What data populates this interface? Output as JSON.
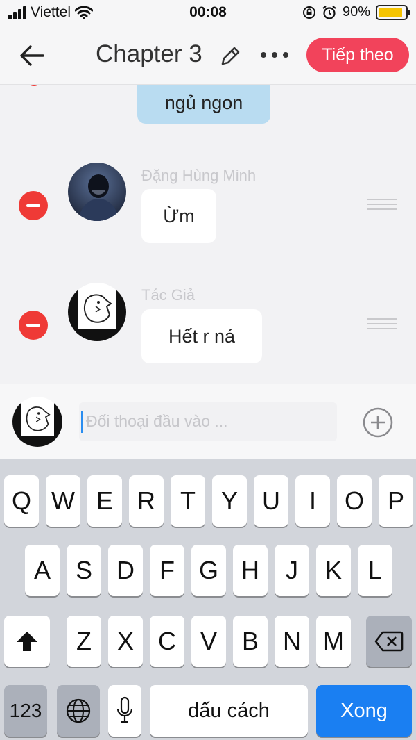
{
  "status_bar": {
    "carrier": "Viettel",
    "time": "00:08",
    "battery_percent": "90%",
    "battery_level": 0.9,
    "battery_color": "#f5c400"
  },
  "nav": {
    "back_icon": "arrow-left-icon",
    "title": "Chapter 3",
    "edit_icon": "pencil-icon",
    "more_icon": "more-horizontal-icon",
    "next_label": "Tiếp theo",
    "accent": "#f2435b"
  },
  "chat": {
    "previous_message": "ngủ ngon",
    "messages": [
      {
        "speaker": "Đặng Hùng Minh",
        "text": "Ừm"
      },
      {
        "speaker": "Tác Giả",
        "text": "Hết r ná"
      }
    ]
  },
  "composer": {
    "placeholder": "Đối thoại đầu vào ...",
    "add_icon": "plus-circle-icon"
  },
  "keyboard": {
    "row1": [
      "Q",
      "W",
      "E",
      "R",
      "T",
      "Y",
      "U",
      "I",
      "O",
      "P"
    ],
    "row2": [
      "A",
      "S",
      "D",
      "F",
      "G",
      "H",
      "J",
      "K",
      "L"
    ],
    "row3": [
      "Z",
      "X",
      "C",
      "V",
      "B",
      "N",
      "M"
    ],
    "shift_icon": "shift-arrow-icon",
    "delete_icon": "backspace-icon",
    "numbers_label": "123",
    "globe_icon": "globe-icon",
    "mic_icon": "microphone-icon",
    "space_label": "dấu cách",
    "done_label": "Xong",
    "done_color": "#1a7ff2"
  }
}
